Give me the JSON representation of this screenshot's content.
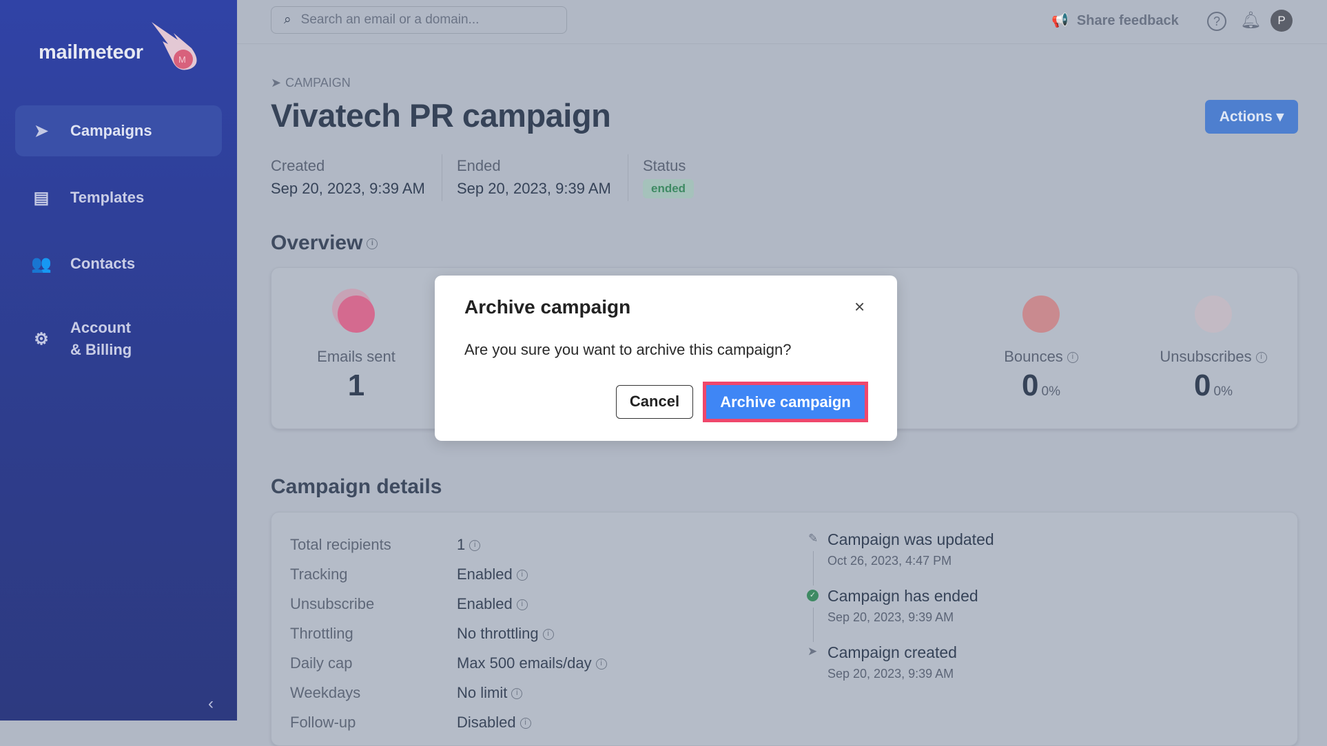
{
  "sidebar": {
    "logo": "mailmeteor",
    "items": [
      {
        "label": "Campaigns",
        "icon": "paper-plane-icon",
        "active": true
      },
      {
        "label": "Templates",
        "icon": "document-icon"
      },
      {
        "label": "Contacts",
        "icon": "users-icon"
      },
      {
        "label": "Account\n& Billing",
        "line1": "Account",
        "line2": "& Billing",
        "icon": "gear-icon"
      }
    ],
    "collapse_icon": "chevron-left-icon"
  },
  "header": {
    "search_placeholder": "Search an email or a domain...",
    "share_feedback": "Share feedback",
    "avatar_initial": "P"
  },
  "page": {
    "breadcrumb": "CAMPAIGN",
    "title": "Vivatech PR campaign",
    "actions_label": "Actions",
    "meta": [
      {
        "label": "Created",
        "value": "Sep 20, 2023, 9:39 AM"
      },
      {
        "label": "Ended",
        "value": "Sep 20, 2023, 9:39 AM"
      },
      {
        "label": "Status",
        "value": "ended"
      }
    ]
  },
  "overview": {
    "title": "Overview",
    "stats": [
      {
        "label": "Emails sent",
        "value": "1"
      },
      {
        "label": "Bounces",
        "value": "0",
        "pct": "0%"
      },
      {
        "label": "Unsubscribes",
        "value": "0",
        "pct": "0%"
      }
    ]
  },
  "details": {
    "title": "Campaign details",
    "rows": [
      {
        "k": "Total recipients",
        "v": "1"
      },
      {
        "k": "Tracking",
        "v": "Enabled"
      },
      {
        "k": "Unsubscribe",
        "v": "Enabled"
      },
      {
        "k": "Throttling",
        "v": "No throttling"
      },
      {
        "k": "Daily cap",
        "v": "Max 500 emails/day"
      },
      {
        "k": "Weekdays",
        "v": "No limit"
      },
      {
        "k": "Follow-up",
        "v": "Disabled"
      }
    ],
    "timeline": [
      {
        "title": "Campaign was updated",
        "date": "Oct 26, 2023, 4:47 PM",
        "icon": "pencil-icon"
      },
      {
        "title": "Campaign has ended",
        "date": "Sep 20, 2023, 9:39 AM",
        "icon": "check-circle-icon"
      },
      {
        "title": "Campaign created",
        "date": "Sep 20, 2023, 9:39 AM",
        "icon": "paper-plane-icon"
      }
    ]
  },
  "modal": {
    "title": "Archive campaign",
    "body": "Are you sure you want to archive this campaign?",
    "cancel": "Cancel",
    "confirm": "Archive campaign"
  },
  "colors": {
    "primary": "#3f86f5",
    "highlight_border": "#f0476b",
    "status_ended": "#3e8a63"
  }
}
